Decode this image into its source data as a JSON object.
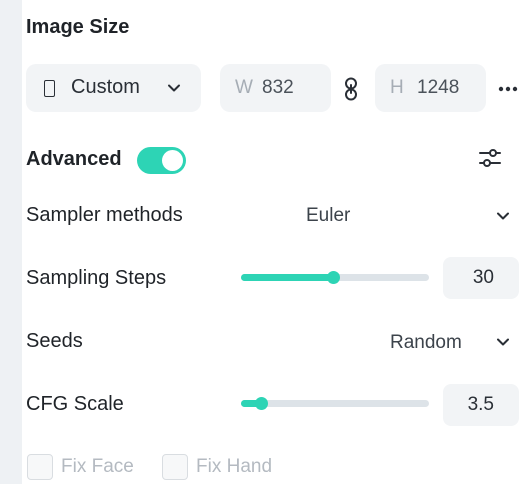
{
  "image_size": {
    "title": "Image Size",
    "ratio_select": "Custom",
    "width": {
      "prefix": "W",
      "value": "832"
    },
    "height": {
      "prefix": "H",
      "value": "1248"
    },
    "icons": {
      "ratio": "portrait-ratio-icon",
      "dropdown": "chevron-down-icon",
      "link": "link-icon",
      "more": "more-horizontal-icon"
    }
  },
  "advanced": {
    "title": "Advanced",
    "toggle_on": true,
    "accent_color": "#2dd4b5",
    "settings_icon": "sliders-icon"
  },
  "sampler": {
    "label": "Sampler methods",
    "value": "Euler"
  },
  "steps": {
    "label": "Sampling Steps",
    "value": "30",
    "fraction": 0.49
  },
  "seeds": {
    "label": "Seeds",
    "value": "Random"
  },
  "cfg": {
    "label": "CFG Scale",
    "value": "3.5",
    "fraction": 0.11
  },
  "options": {
    "fix_face": {
      "label": "Fix Face",
      "checked": false
    },
    "fix_hand": {
      "label": "Fix Hand",
      "checked": false
    }
  }
}
